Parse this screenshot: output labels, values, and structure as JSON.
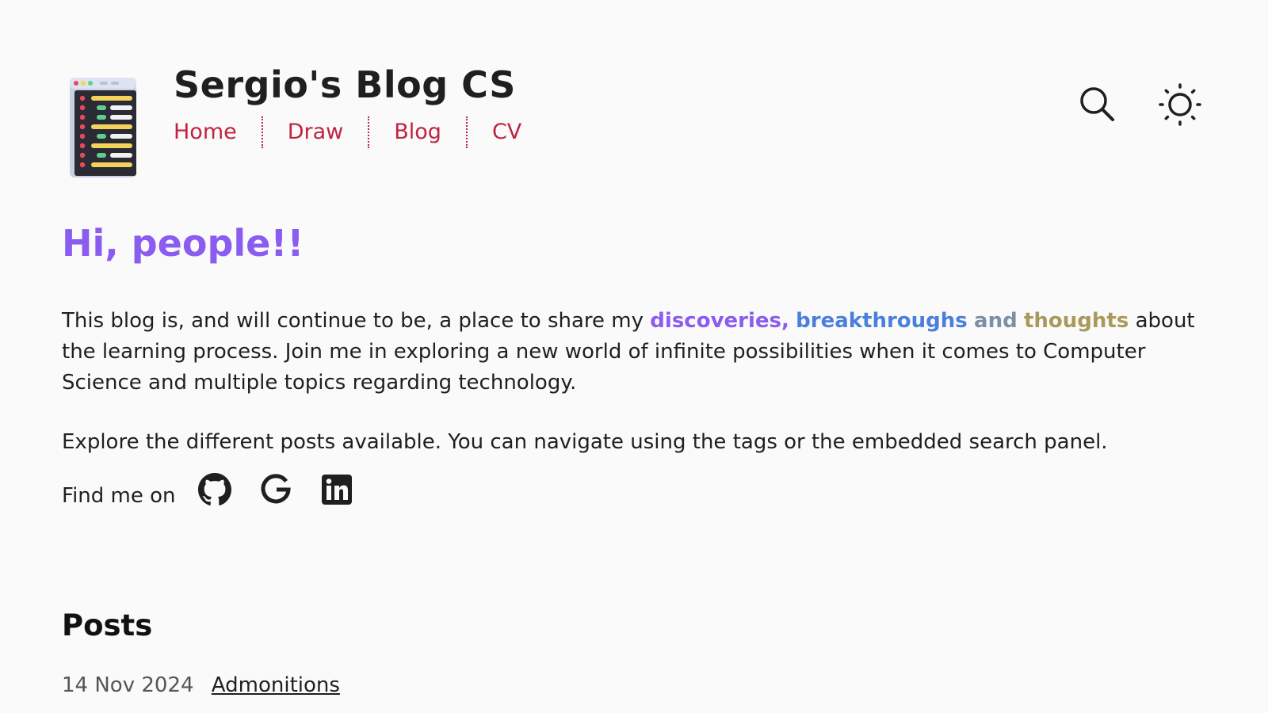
{
  "header": {
    "site_title": "Sergio's Blog CS",
    "logo_icon": "code-editor-icon",
    "nav": [
      {
        "label": "Home"
      },
      {
        "label": "Draw"
      },
      {
        "label": "Blog"
      },
      {
        "label": "CV"
      }
    ],
    "search_icon": "search-icon",
    "theme_icon": "sun-icon"
  },
  "hero": {
    "title": "Hi, people!!",
    "intro_start": "This blog is, and will continue to be, a place to share my ",
    "highlight_1": "discoveries,",
    "highlight_2": "breakthroughs",
    "highlight_3": "and",
    "highlight_4": "thoughts",
    "intro_end": "about the learning process. Join me in exploring a new world of infinite possibilities when it comes to Computer Science and multiple topics regarding technology.",
    "explore": "Explore the different posts available. You can navigate using the tags or the embedded search panel.",
    "find_me": "Find me on",
    "social": [
      {
        "icon": "github-icon"
      },
      {
        "icon": "google-icon"
      },
      {
        "icon": "linkedin-icon"
      }
    ]
  },
  "posts": {
    "title": "Posts",
    "items": [
      {
        "date": "14 Nov 2024",
        "title": "Admonitions"
      }
    ]
  },
  "colors": {
    "accent_nav": "#c0233f",
    "hero_title": "#8a5cf0",
    "highlight_purple": "#8a5cf0",
    "highlight_blue": "#4a80dc",
    "highlight_gray": "#7d8fa6",
    "highlight_olive": "#a79a5a"
  }
}
